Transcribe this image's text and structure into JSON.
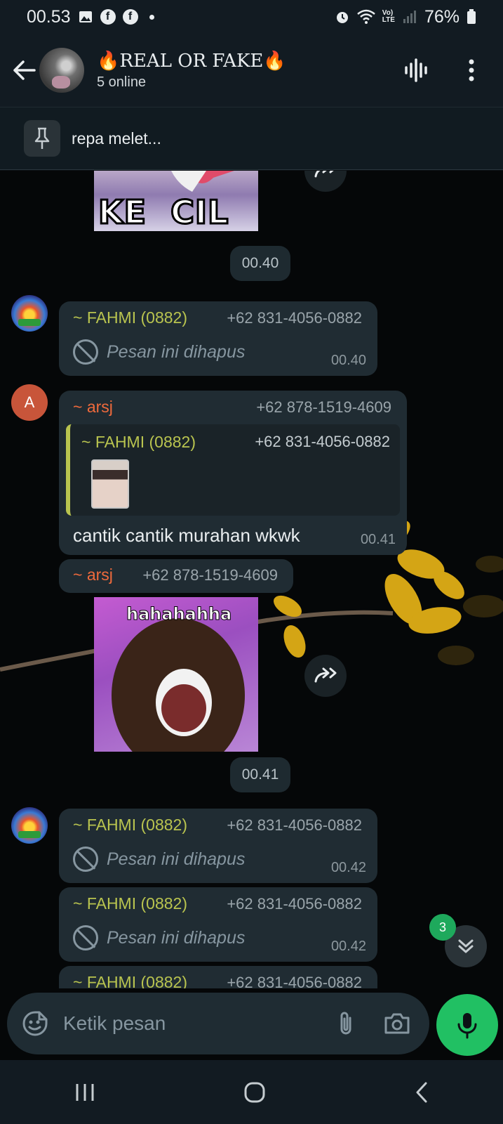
{
  "status_bar": {
    "time": "00.53",
    "battery": "76%",
    "network_label_top": "Vo)",
    "network_label_bottom": "LTE"
  },
  "header": {
    "title": "🔥REAL OR FAKE🔥",
    "subtitle": "5 online",
    "icons": [
      "back-arrow-icon",
      "group-avatar",
      "voice-chat-icon",
      "more-vert-icon"
    ]
  },
  "pinned": {
    "text": "repa melet..."
  },
  "chat": {
    "sticker_top_text": "KE  CIL",
    "date_chips": [
      "00.40",
      "00.41"
    ],
    "messages": [
      {
        "sender": "~ FAHMI (0882)",
        "phone": "+62 831-4056-0882",
        "text": "Pesan ini dihapus",
        "time": "00.40"
      },
      {
        "sender": "~ arsj",
        "phone": "+62 878-1519-4609",
        "quote_sender": "~ FAHMI (0882)",
        "quote_phone": "+62 831-4056-0882",
        "text": "cantik cantik murahan wkwk",
        "time": "00.41"
      },
      {
        "sender": "~ arsj",
        "phone": "+62 878-1519-4609",
        "sticker_text": "hahahahha"
      },
      {
        "sender": "~ FAHMI (0882)",
        "phone": "+62 831-4056-0882",
        "text": "Pesan ini dihapus",
        "time": "00.42"
      },
      {
        "sender": "~ FAHMI (0882)",
        "phone": "+62 831-4056-0882",
        "text": "Pesan ini dihapus",
        "time": "00.42"
      },
      {
        "sender": "~ FAHMI (0882)",
        "phone": "+62 831-4056-0882"
      }
    ],
    "avatar_letter": "A",
    "unread_count": "3"
  },
  "composer": {
    "placeholder": "Ketik pesan"
  }
}
